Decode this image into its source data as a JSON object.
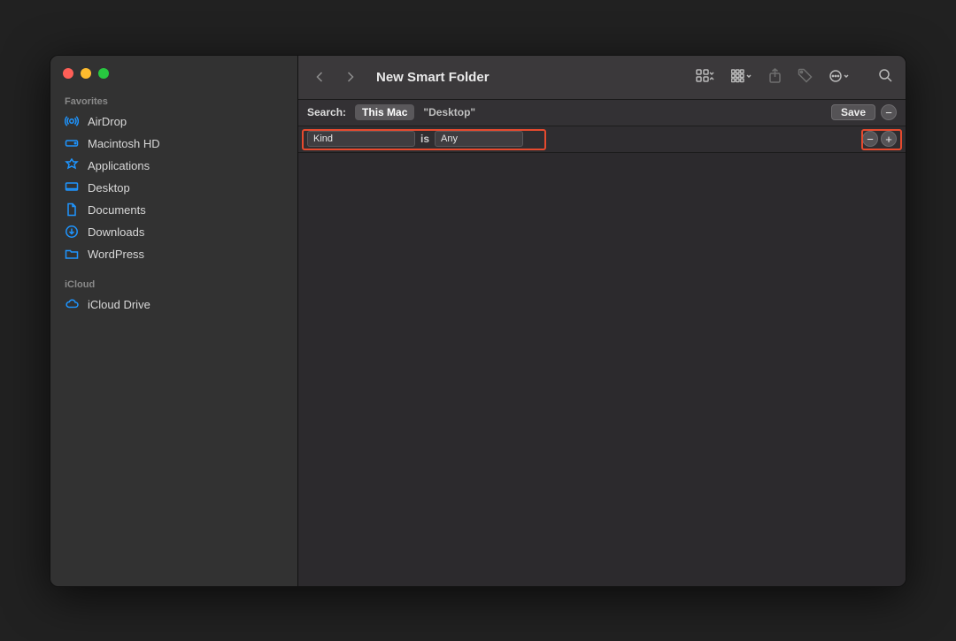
{
  "window": {
    "title": "New Smart Folder"
  },
  "sidebar": {
    "sections": [
      {
        "label": "Favorites",
        "items": [
          {
            "icon": "airdrop-icon",
            "label": "AirDrop"
          },
          {
            "icon": "hdd-icon",
            "label": "Macintosh HD"
          },
          {
            "icon": "apps-icon",
            "label": "Applications"
          },
          {
            "icon": "desktop-icon",
            "label": "Desktop"
          },
          {
            "icon": "doc-icon",
            "label": "Documents"
          },
          {
            "icon": "download-icon",
            "label": "Downloads"
          },
          {
            "icon": "folder-icon",
            "label": "WordPress"
          }
        ]
      },
      {
        "label": "iCloud",
        "items": [
          {
            "icon": "cloud-icon",
            "label": "iCloud Drive"
          }
        ]
      }
    ]
  },
  "search": {
    "label": "Search:",
    "scope_active": "This Mac",
    "scope_inactive": "\"Desktop\"",
    "save_label": "Save"
  },
  "criteria": {
    "attribute": "Kind",
    "operator": "is",
    "value": "Any"
  },
  "highlight_color": "#e64a2e"
}
